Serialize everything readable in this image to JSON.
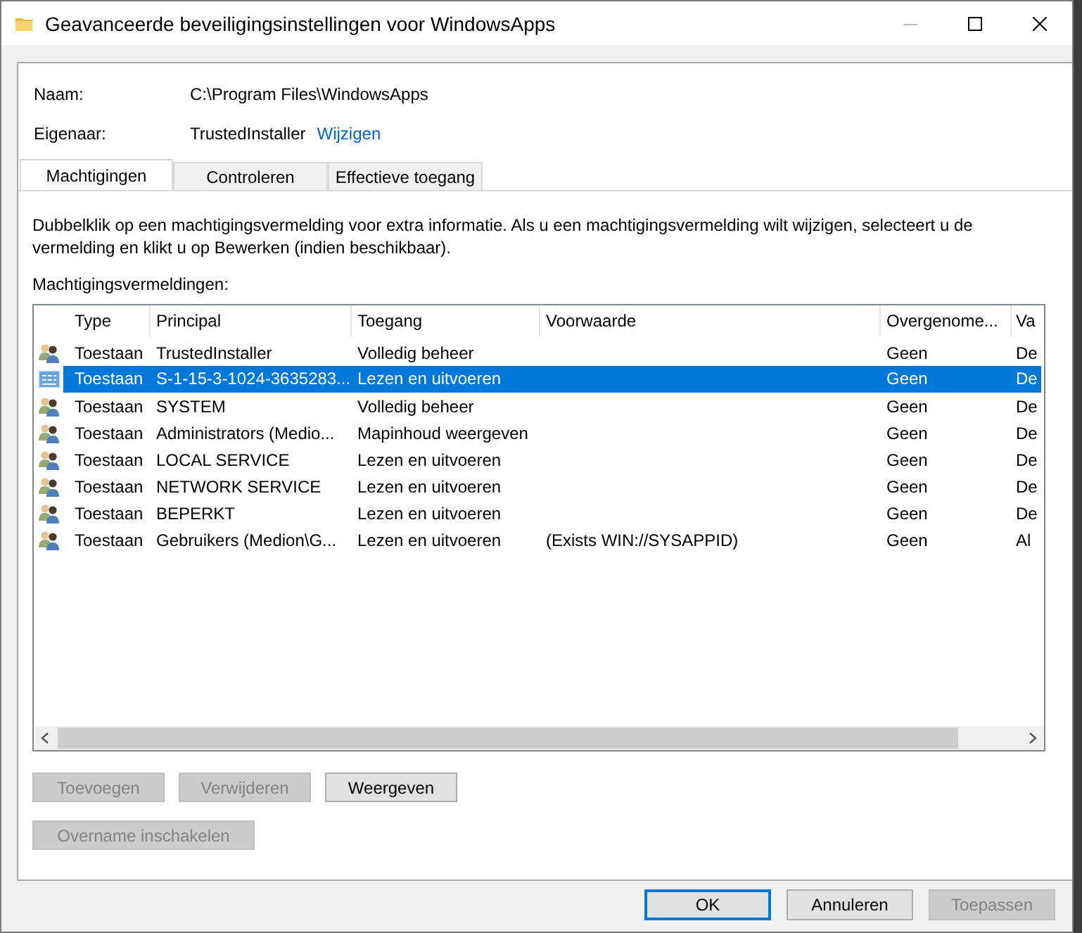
{
  "window": {
    "title": "Geavanceerde beveiligingsinstellingen voor WindowsApps"
  },
  "fields": [
    {
      "label": "Naam:",
      "value": "C:\\Program Files\\WindowsApps"
    },
    {
      "label": "Eigenaar:",
      "value": "TrustedInstaller",
      "link": "Wijzigen"
    }
  ],
  "tabs": [
    {
      "label": "Machtigingen",
      "selected": true
    },
    {
      "label": "Controleren",
      "selected": false
    },
    {
      "label": "Effectieve toegang",
      "selected": false
    }
  ],
  "description": "Dubbelklik op een machtigingsvermelding voor extra informatie. Als u een machtigingsvermelding wilt wijzigen, selecteert u de vermelding en klikt u op Bewerken (indien beschikbaar).",
  "list_label": "Machtigingsvermeldingen:",
  "table": {
    "columns": [
      "Type",
      "Principal",
      "Toegang",
      "Voorwaarde",
      "Overgenome...",
      "Va"
    ],
    "rows": [
      {
        "kind": "group",
        "selected": false,
        "cells": [
          "Toestaan",
          "TrustedInstaller",
          "Volledig beheer",
          "",
          "Geen",
          "De"
        ]
      },
      {
        "kind": "app",
        "selected": true,
        "cells": [
          "Toestaan",
          "S-1-15-3-1024-3635283...",
          "Lezen en uitvoeren",
          "",
          "Geen",
          "De"
        ]
      },
      {
        "kind": "group",
        "selected": false,
        "cells": [
          "Toestaan",
          "SYSTEM",
          "Volledig beheer",
          "",
          "Geen",
          "De"
        ]
      },
      {
        "kind": "group",
        "selected": false,
        "cells": [
          "Toestaan",
          "Administrators (Medio...",
          "Mapinhoud weergeven",
          "",
          "Geen",
          "De"
        ]
      },
      {
        "kind": "group",
        "selected": false,
        "cells": [
          "Toestaan",
          "LOCAL SERVICE",
          "Lezen en uitvoeren",
          "",
          "Geen",
          "De"
        ]
      },
      {
        "kind": "group",
        "selected": false,
        "cells": [
          "Toestaan",
          "NETWORK SERVICE",
          "Lezen en uitvoeren",
          "",
          "Geen",
          "De"
        ]
      },
      {
        "kind": "group",
        "selected": false,
        "cells": [
          "Toestaan",
          "BEPERKT",
          "Lezen en uitvoeren",
          "",
          "Geen",
          "De"
        ]
      },
      {
        "kind": "group",
        "selected": false,
        "cells": [
          "Toestaan",
          "Gebruikers (Medion\\G...",
          "Lezen en uitvoeren",
          "(Exists WIN://SYSAPPID)",
          "Geen",
          "Al"
        ]
      }
    ]
  },
  "buttons": [
    {
      "label": "Toevoegen",
      "disabled": true
    },
    {
      "label": "Verwijderen",
      "disabled": true
    },
    {
      "label": "Weergeven",
      "disabled": false
    }
  ],
  "inheritance_button": {
    "label": "Overname inschakelen",
    "disabled": true
  },
  "dialog_buttons": [
    {
      "label": "OK",
      "disabled": false,
      "default": true
    },
    {
      "label": "Annuleren",
      "disabled": false,
      "default": false
    },
    {
      "label": "Toepassen",
      "disabled": true,
      "default": false
    }
  ]
}
